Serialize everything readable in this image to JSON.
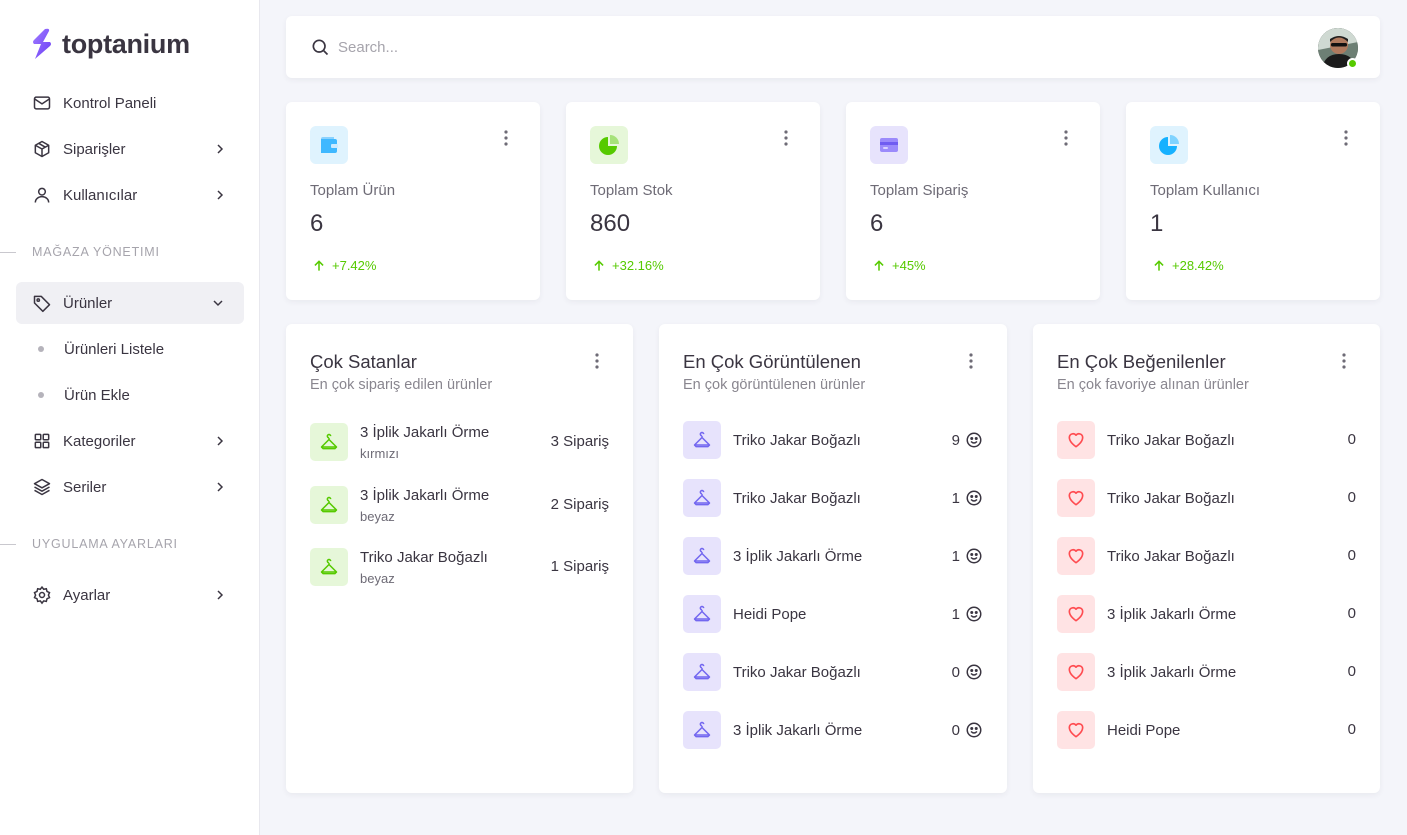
{
  "brand": {
    "name": "toptanium"
  },
  "sidebar": {
    "items": [
      {
        "label": "Kontrol Paneli",
        "icon": "mail-icon"
      },
      {
        "label": "Siparişler",
        "icon": "box-icon"
      },
      {
        "label": "Kullanıcılar",
        "icon": "user-icon"
      }
    ],
    "section1": "MAĞAZA YÖNETIMI",
    "products": {
      "label": "Ürünler",
      "icon": "tag-icon",
      "sub": [
        "Ürünleri Listele",
        "Ürün Ekle"
      ]
    },
    "more_items": [
      {
        "label": "Kategoriler",
        "icon": "grid-icon"
      },
      {
        "label": "Seriler",
        "icon": "layers-icon"
      }
    ],
    "section2": "UYGULAMA AYARLARI",
    "settings": {
      "label": "Ayarlar",
      "icon": "gear-icon"
    }
  },
  "search": {
    "placeholder": "Search..."
  },
  "stats": [
    {
      "label": "Toplam Ürün",
      "value": "6",
      "trend": "+7.42%",
      "color": "#16b1ff"
    },
    {
      "label": "Toplam Stok",
      "value": "860",
      "trend": "+32.16%",
      "color": "#56ca00"
    },
    {
      "label": "Toplam Sipariş",
      "value": "6",
      "trend": "+45%",
      "color": "#9155fd"
    },
    {
      "label": "Toplam Kullanıcı",
      "value": "1",
      "trend": "+28.42%",
      "color": "#16b1ff"
    }
  ],
  "best_sellers": {
    "title": "Çok Satanlar",
    "subtitle": "En çok sipariş edilen ürünler",
    "rows": [
      {
        "name": "3 İplik Jakarlı Örme",
        "variant": "kırmızı",
        "value": "3 Sipariş"
      },
      {
        "name": "3 İplik Jakarlı Örme",
        "variant": "beyaz",
        "value": "2 Sipariş"
      },
      {
        "name": "Triko Jakar Boğazlı",
        "variant": "beyaz",
        "value": "1 Sipariş"
      }
    ]
  },
  "most_viewed": {
    "title": "En Çok Görüntülenen",
    "subtitle": "En çok görüntülenen ürünler",
    "rows": [
      {
        "name": "Triko Jakar Boğazlı",
        "value": "9"
      },
      {
        "name": "Triko Jakar Boğazlı",
        "value": "1"
      },
      {
        "name": "3 İplik Jakarlı Örme",
        "value": "1"
      },
      {
        "name": "Heidi Pope",
        "value": "1"
      },
      {
        "name": "Triko Jakar Boğazlı",
        "value": "0"
      },
      {
        "name": "3 İplik Jakarlı Örme",
        "value": "0"
      }
    ]
  },
  "most_liked": {
    "title": "En Çok Beğenilenler",
    "subtitle": "En çok favoriye alınan ürünler",
    "rows": [
      {
        "name": "Triko Jakar Boğazlı",
        "value": "0"
      },
      {
        "name": "Triko Jakar Boğazlı",
        "value": "0"
      },
      {
        "name": "Triko Jakar Boğazlı",
        "value": "0"
      },
      {
        "name": "3 İplik Jakarlı Örme",
        "value": "0"
      },
      {
        "name": "3 İplik Jakarlı Örme",
        "value": "0"
      },
      {
        "name": "Heidi Pope",
        "value": "0"
      }
    ]
  },
  "colors": {
    "success": "#56ca00",
    "primary": "#9155fd",
    "info": "#16b1ff",
    "error": "#ff4c51"
  }
}
